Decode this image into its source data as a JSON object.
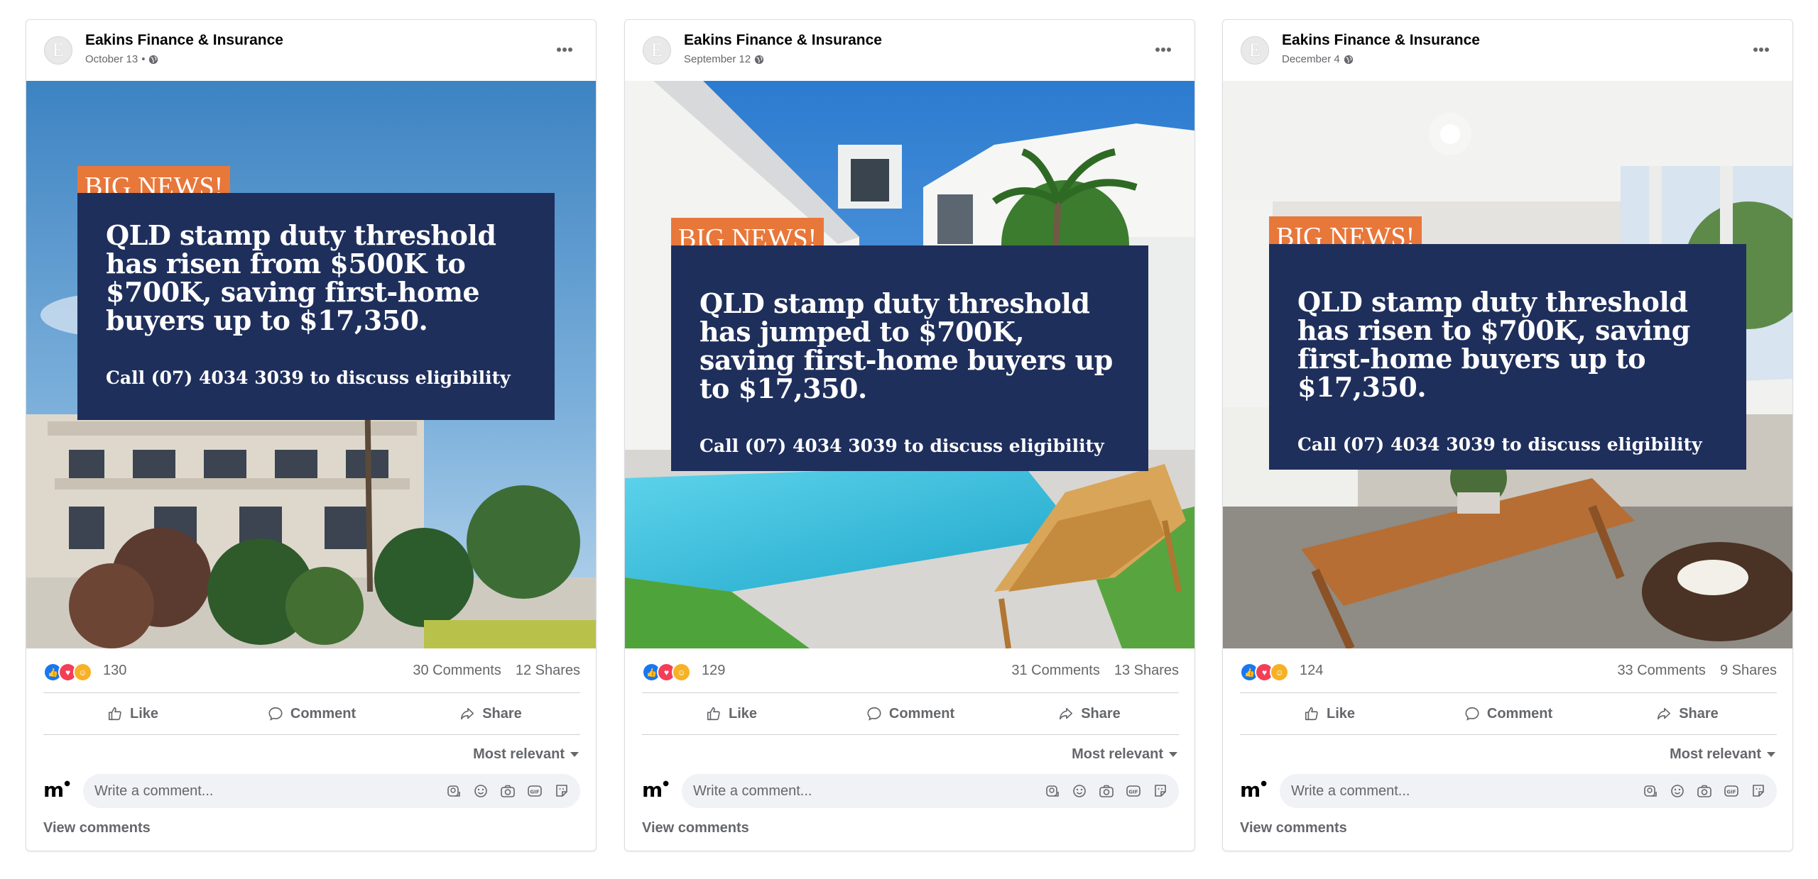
{
  "posts": [
    {
      "page_name": "Eakins Finance & Insurance",
      "date": "October 13",
      "date_separator": "•",
      "avatar_letter": "E",
      "badge": "BIG NEWS!",
      "headline": "QLD stamp duty threshold has risen from $500K to $700K, saving first-home buyers up to $17,350.",
      "cta": "Call (07) 4034 3039 to discuss eligibility",
      "reaction_count": "130",
      "comments": "30 Comments",
      "shares": "12 Shares",
      "image_scene": "apartment-building-palm-trees"
    },
    {
      "page_name": "Eakins Finance & Insurance",
      "date": "September 12",
      "date_separator": "",
      "avatar_letter": "E",
      "badge": "BIG NEWS!",
      "headline": "QLD stamp duty threshold has jumped to $700K, saving first-home buyers up to $17,350.",
      "cta": "Call (07) 4034 3039 to discuss eligibility",
      "reaction_count": "129",
      "comments": "31 Comments",
      "shares": "13 Shares",
      "image_scene": "house-with-pool"
    },
    {
      "page_name": "Eakins Finance & Insurance",
      "date": "December 4",
      "date_separator": "",
      "avatar_letter": "E",
      "badge": "BIG NEWS!",
      "headline": "QLD stamp duty threshold has risen to $700K, saving first-home buyers up to $17,350.",
      "cta": "Call (07) 4034 3039 to discuss eligibility",
      "reaction_count": "124",
      "comments": "33 Comments",
      "shares": "9 Shares",
      "image_scene": "patio-living-room"
    }
  ],
  "actions": {
    "like": "Like",
    "comment": "Comment",
    "share": "Share"
  },
  "sort_label": "Most relevant",
  "comment_placeholder": "Write a comment...",
  "view_comments": "View comments",
  "brand_logo": "m",
  "colors": {
    "badge": "#e8773a",
    "panel": "#1f2f5c",
    "like_blue": "#1877f2",
    "love_red": "#f33e58",
    "care_yellow": "#f7b125",
    "muted_text": "#65676b"
  },
  "icons": {
    "more": "more-dots-icon",
    "privacy": "globe-icon",
    "reactions": [
      "like-reaction-icon",
      "love-reaction-icon",
      "care-reaction-icon"
    ],
    "comment_tools": [
      "avatar-sticker-icon",
      "emoji-icon",
      "camera-icon",
      "gif-icon",
      "sticker-icon"
    ]
  }
}
